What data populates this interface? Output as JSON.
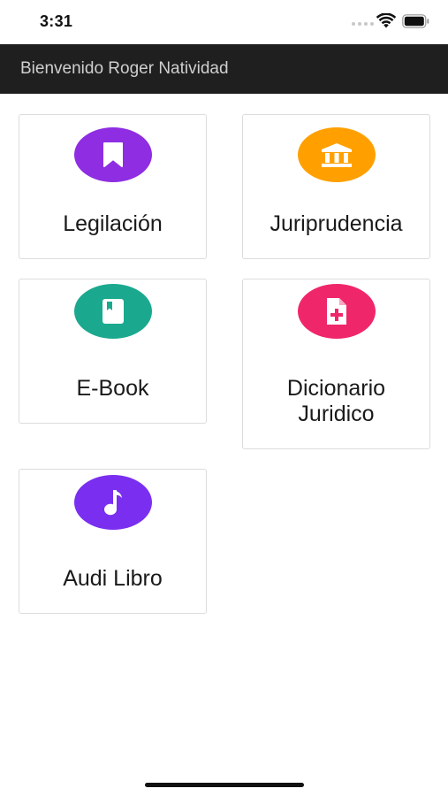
{
  "status_bar": {
    "time": "3:31",
    "wifi_icon": "wifi-icon",
    "battery_icon": "battery-icon"
  },
  "header": {
    "title": "Bienvenido Roger Natividad",
    "background": "#1f1f1f"
  },
  "menu": {
    "items": [
      {
        "label": "Legilación",
        "icon": "bookmark-icon",
        "color": "#8e2de2"
      },
      {
        "label": "Juriprudencia",
        "icon": "institution-icon",
        "color": "#ffa000"
      },
      {
        "label": "E-Book",
        "icon": "book-icon",
        "color": "#1aa98f"
      },
      {
        "label": "Dicionario Juridico",
        "icon": "file-add-icon",
        "color": "#f0266b"
      },
      {
        "label": "Audi Libro",
        "icon": "music-note-icon",
        "color": "#7a2ff0"
      }
    ]
  }
}
